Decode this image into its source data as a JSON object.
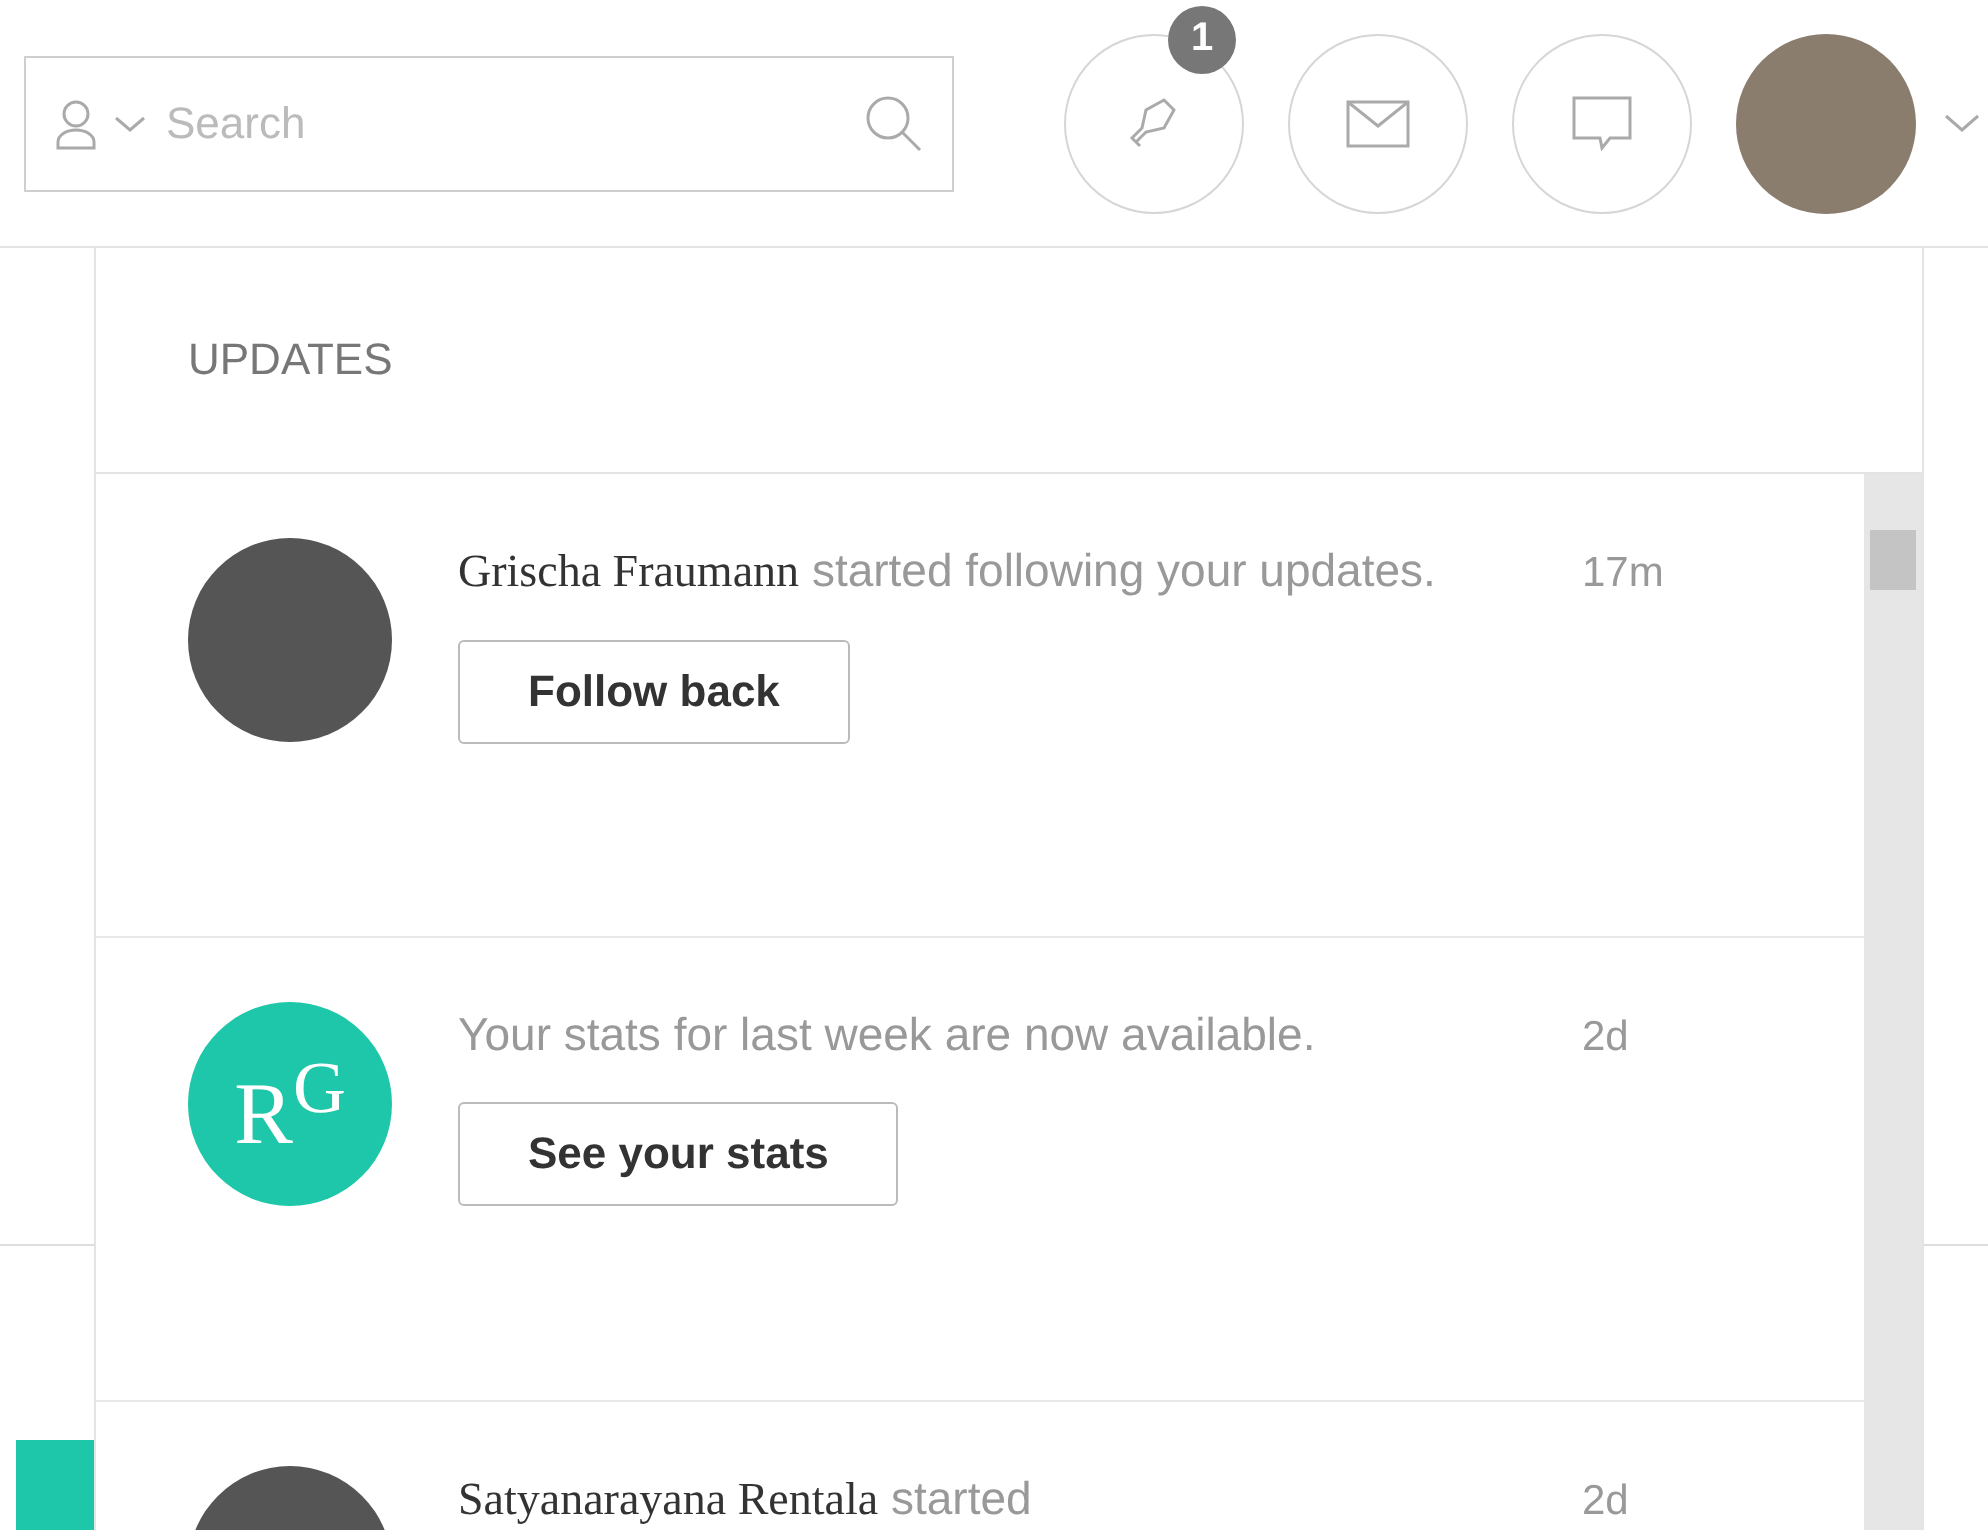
{
  "search": {
    "placeholder": "Search"
  },
  "toolbar": {
    "notifications_badge": "1"
  },
  "updates": {
    "title": "UPDATES",
    "items": [
      {
        "kind": "follow",
        "actor": "Grischa Fraumann",
        "message": "started following your updates.",
        "time": "17m",
        "button": "Follow back"
      },
      {
        "kind": "stats",
        "logo": "R$^{G}$",
        "message": "Your stats for last week are now available.",
        "time": "2d",
        "button": "See your stats"
      },
      {
        "kind": "follow",
        "actor": "Satyanarayana Rentala",
        "message": "started",
        "time": "2d"
      }
    ]
  }
}
